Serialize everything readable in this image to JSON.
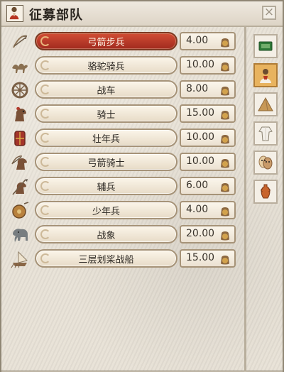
{
  "window": {
    "title": "征募部队",
    "close_symbol": "×"
  },
  "units": [
    {
      "name": "弓箭步兵",
      "cost": "4.00",
      "selected": true,
      "icon": "archer-bow-icon"
    },
    {
      "name": "骆驼骑兵",
      "cost": "10.00",
      "selected": false,
      "icon": "camel-icon"
    },
    {
      "name": "战车",
      "cost": "8.00",
      "selected": false,
      "icon": "chariot-wheel-icon"
    },
    {
      "name": "骑士",
      "cost": "15.00",
      "selected": false,
      "icon": "knight-horse-icon"
    },
    {
      "name": "壮年兵",
      "cost": "10.00",
      "selected": false,
      "icon": "shield-icon"
    },
    {
      "name": "弓箭骑士",
      "cost": "10.00",
      "selected": false,
      "icon": "horse-archer-icon"
    },
    {
      "name": "辅兵",
      "cost": "6.00",
      "selected": false,
      "icon": "spear-horse-icon"
    },
    {
      "name": "少年兵",
      "cost": "4.00",
      "selected": false,
      "icon": "round-shield-icon"
    },
    {
      "name": "战象",
      "cost": "20.00",
      "selected": false,
      "icon": "elephant-icon"
    },
    {
      "name": "三层划桨战船",
      "cost": "15.00",
      "selected": false,
      "icon": "ship-icon"
    }
  ],
  "sidebar": [
    {
      "icon": "money-icon",
      "active": false
    },
    {
      "icon": "soldier-portrait-icon",
      "active": true
    },
    {
      "icon": "pyramid-icon",
      "active": false
    },
    {
      "icon": "tunic-icon",
      "active": false
    },
    {
      "icon": "masks-icon",
      "active": false
    },
    {
      "icon": "amphora-icon",
      "active": false
    }
  ],
  "colors": {
    "selected_button": "#b73522",
    "parchment": "#e8e2d7",
    "border": "#a69378"
  }
}
